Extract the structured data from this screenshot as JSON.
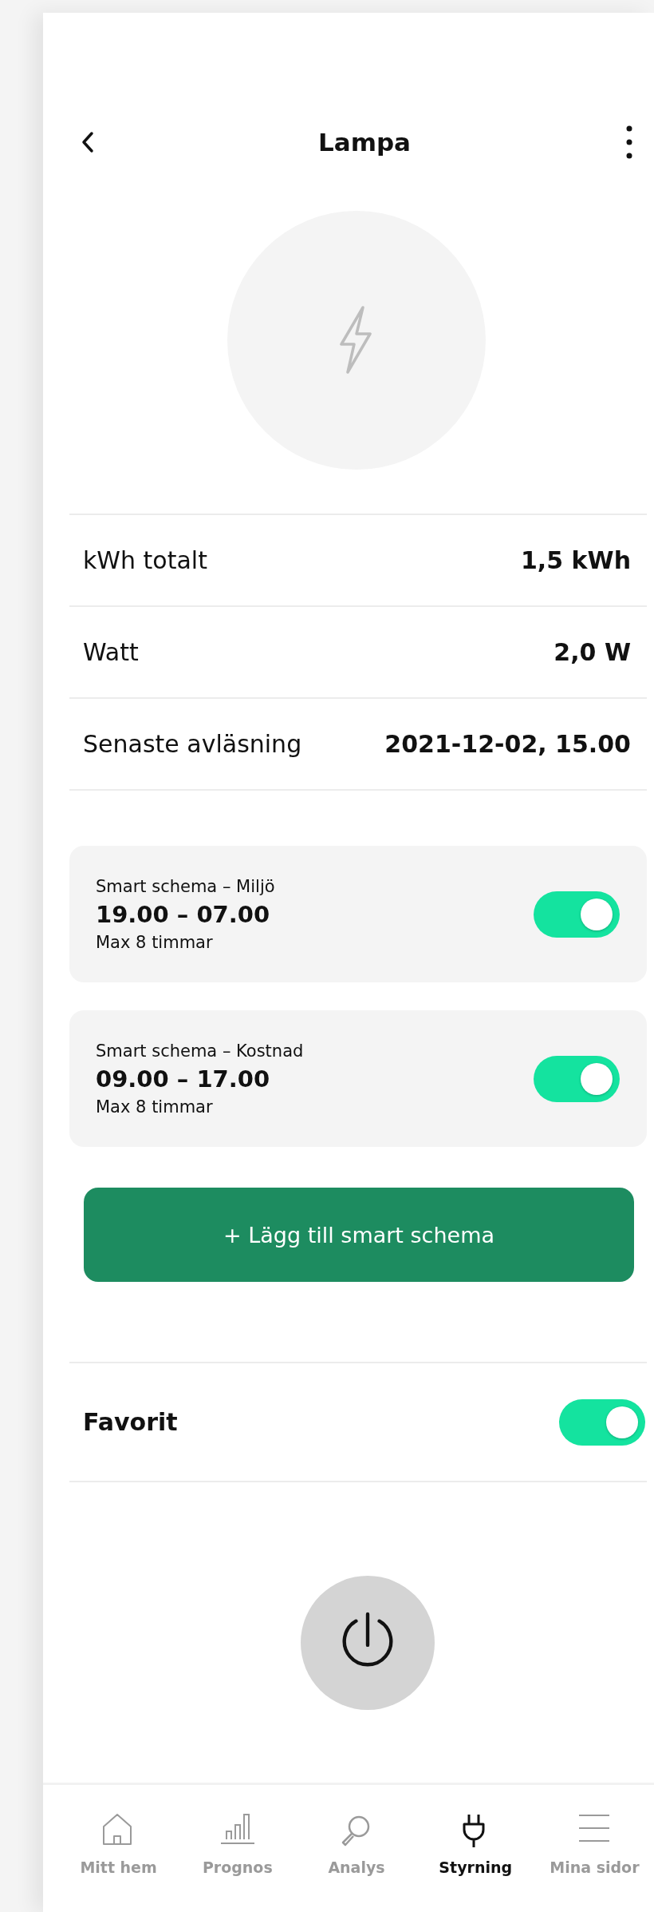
{
  "header": {
    "title": "Lampa"
  },
  "readings": [
    {
      "label": "kWh totalt",
      "value": "1,5 kWh"
    },
    {
      "label": "Watt",
      "value": "2,0 W"
    },
    {
      "label": "Senaste avläsning",
      "value": "2021-12-02, 15.00"
    }
  ],
  "schedules": [
    {
      "name": "Smart schema – Miljö",
      "time": "19.00 – 07.00",
      "limit": "Max 8 timmar",
      "on": true
    },
    {
      "name": "Smart schema – Kostnad",
      "time": "09.00 – 17.00",
      "limit": "Max 8 timmar",
      "on": true
    }
  ],
  "add_button": "+ Lägg till smart schema",
  "favorite": {
    "label": "Favorit",
    "on": true
  },
  "nav": [
    {
      "label": "Mitt hem",
      "kind": "home",
      "selected": false
    },
    {
      "label": "Prognos",
      "kind": "bars",
      "selected": false
    },
    {
      "label": "Analys",
      "kind": "search",
      "selected": false
    },
    {
      "label": "Styrning",
      "kind": "plug",
      "selected": true
    },
    {
      "label": "Mina sidor",
      "kind": "menu",
      "selected": false
    }
  ]
}
